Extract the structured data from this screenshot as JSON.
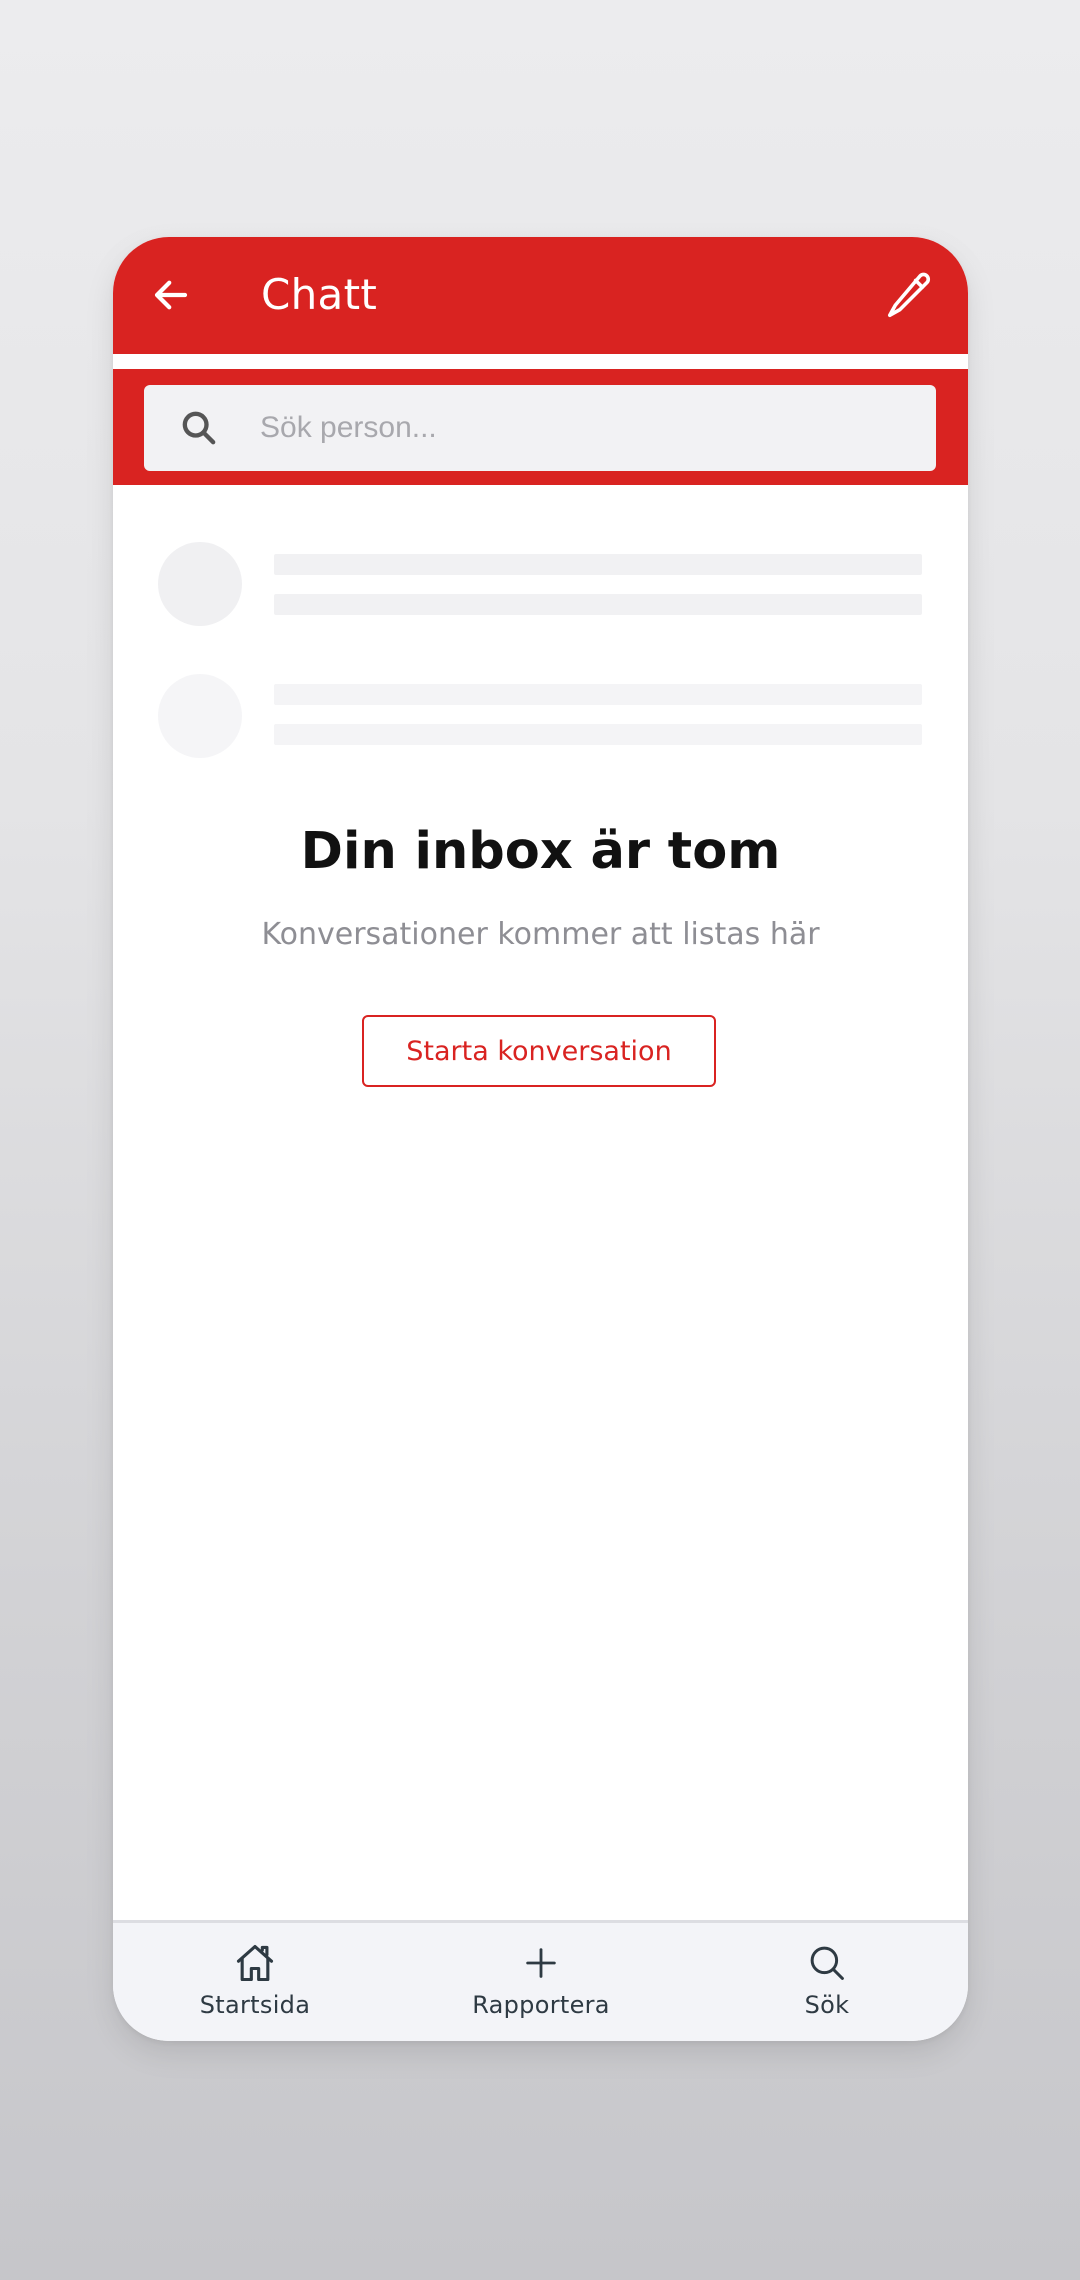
{
  "header": {
    "title": "Chatt",
    "back_icon": "arrow-left-icon",
    "edit_icon": "pencil-icon"
  },
  "search": {
    "placeholder": "Sök person...",
    "value": "",
    "icon": "search-icon"
  },
  "empty_state": {
    "title": "Din inbox är tom",
    "subtitle": "Konversationer kommer att listas här",
    "button_label": "Starta konversation"
  },
  "bottom_nav": {
    "items": [
      {
        "label": "Startsida",
        "icon": "home-icon"
      },
      {
        "label": "Rapportera",
        "icon": "plus-icon"
      },
      {
        "label": "Sök",
        "icon": "search-icon"
      }
    ]
  },
  "colors": {
    "brand_red": "#d92321",
    "background": "#ffffff",
    "nav_background": "#f3f4f8",
    "skeleton": "#f1f1f3"
  }
}
